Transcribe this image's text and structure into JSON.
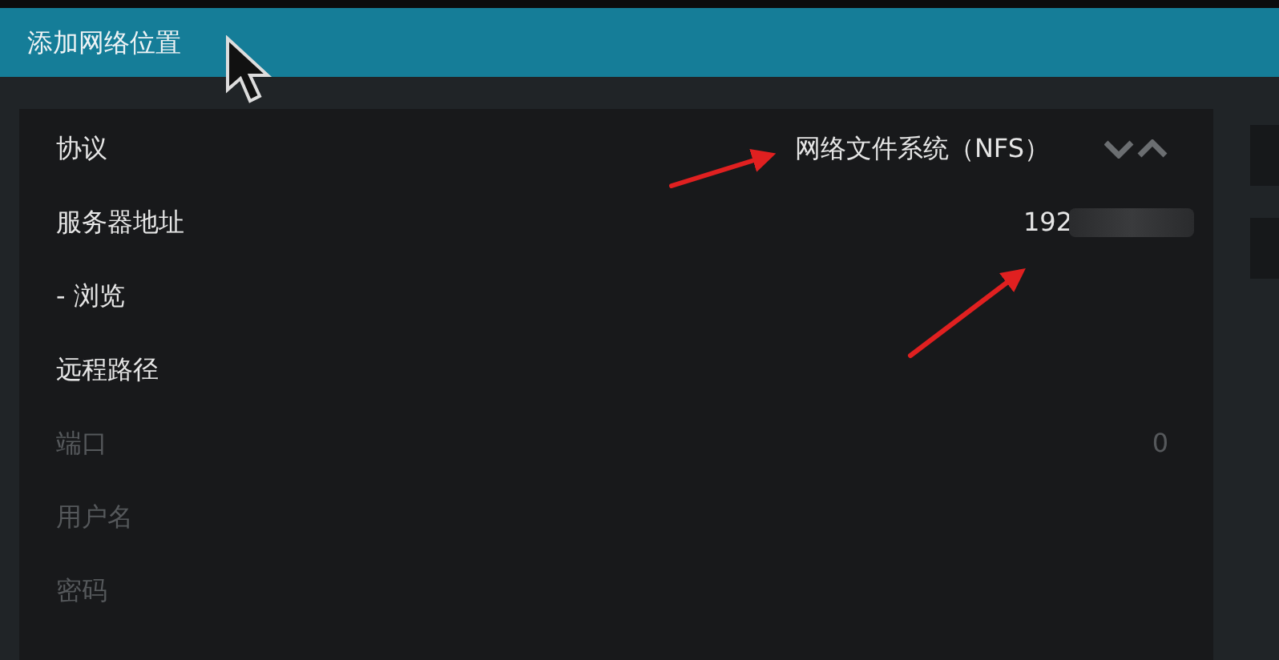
{
  "window": {
    "title": "添加网络位置"
  },
  "settings": [
    {
      "label": "协议",
      "value": "网络文件系统（NFS）",
      "disabled": false,
      "kind": "spinner"
    },
    {
      "label": "服务器地址",
      "value": "192",
      "disabled": false,
      "kind": "redacted"
    },
    {
      "label": "- 浏览",
      "disabled": false,
      "kind": "plain"
    },
    {
      "label": "远程路径",
      "disabled": false,
      "kind": "plain"
    },
    {
      "label": "端口",
      "value": "0",
      "disabled": true,
      "kind": "plain"
    },
    {
      "label": "用户名",
      "disabled": true,
      "kind": "plain"
    },
    {
      "label": "密码",
      "disabled": true,
      "kind": "plain"
    }
  ]
}
